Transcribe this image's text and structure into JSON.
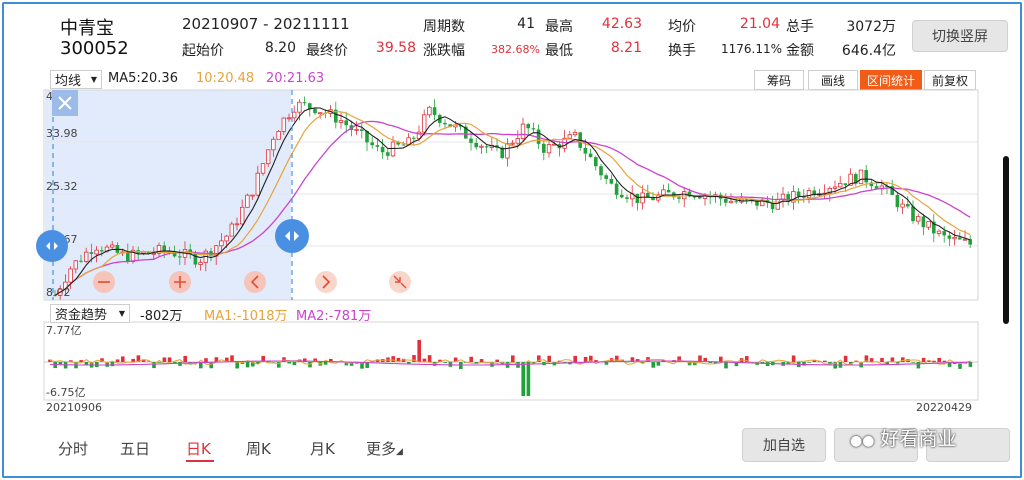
{
  "stock": {
    "name": "中青宝",
    "code": "300052"
  },
  "range": {
    "start": "20210907",
    "sep": " - ",
    "end": "20211111"
  },
  "stats": {
    "periods_label": "周期数",
    "periods": "41",
    "high_label": "最高",
    "high": "42.63",
    "avg_label": "均价",
    "avg": "21.04",
    "total_hands_label": "总手",
    "total_hands": "3072万",
    "open_label": "起始价",
    "open": "8.20",
    "close_label": "最终价",
    "close": "39.58",
    "change_label": "涨跌幅",
    "change": "382.68%",
    "low_label": "最低",
    "low": "8.21",
    "turnover_label": "换手",
    "turnover": "1176.11%",
    "amount_label": "金额",
    "amount": "646.4亿"
  },
  "toggle_button": "切换竖屏",
  "ma": {
    "selector": "均线",
    "ma5": "MA5:20.36",
    "ma10": "10:20.48",
    "ma20": "20:21.63"
  },
  "tools": {
    "chips": "筹码",
    "draw": "画线",
    "range_stats": "区间统计",
    "restore": "前复权"
  },
  "price_axis": [
    "42.63",
    "33.98",
    "25.32",
    "16.67",
    "8.02"
  ],
  "flow": {
    "selector": "资金趋势",
    "value": "-802万",
    "ma1": "MA1:-1018万",
    "ma2": "MA2:-781万",
    "max": "7.77亿",
    "min": "-6.75亿",
    "date_start": "20210906",
    "date_end": "20220429"
  },
  "periods": [
    "分时",
    "五日",
    "日K",
    "周K",
    "月K",
    "更多"
  ],
  "selected_period": "日K",
  "add_watch": "加自选",
  "watermark": "好看商业",
  "colors": {
    "up": "#e0313b",
    "down": "#21a13a",
    "ma5": "#222222",
    "ma10": "#e8a33a",
    "ma20": "#cc44cc",
    "selection": "#dce8fb",
    "accent": "#f25c19",
    "handle": "#4a90e2"
  },
  "icons": [
    "close-icon",
    "zoom-out-icon",
    "zoom-in-icon",
    "arrow-left-icon",
    "arrow-right-icon",
    "shrink-icon",
    "drag-handle-icon"
  ]
}
